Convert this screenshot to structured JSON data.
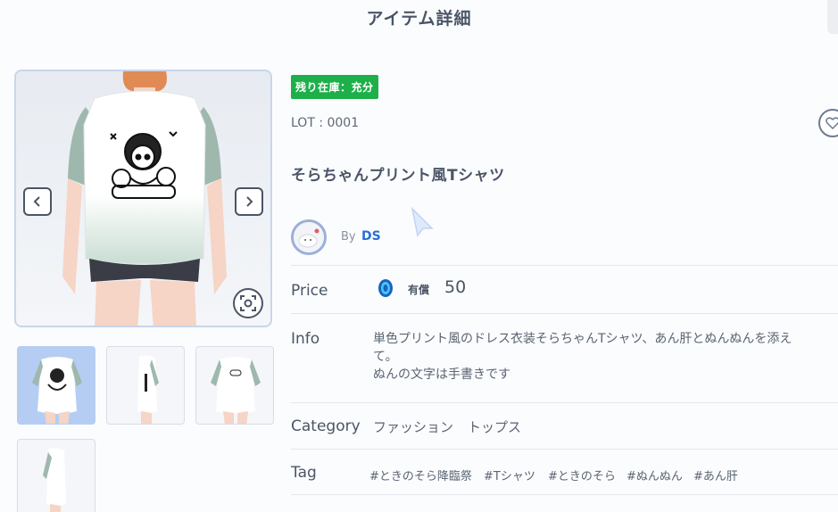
{
  "header": {
    "title": "アイテム詳細"
  },
  "item": {
    "stock_badge": "残り在庫：充分",
    "lot": "LOT : 0001",
    "name": "そらちゃんプリント風Tシャツ",
    "creator_by": "By",
    "creator_name": "DS"
  },
  "details": {
    "price_label": "Price",
    "price_type": "有償",
    "price_value": "50",
    "info_label": "Info",
    "info_lines": [
      "単色プリント風のドレス衣装そらちゃんTシャツ、あん肝とぬんぬんを添え",
      "て。",
      "ぬんの文字は手書きです"
    ],
    "category_label": "Category",
    "categories": [
      "ファッション",
      "トップス"
    ],
    "tag_label": "Tag",
    "tags": [
      "#ときのそら降臨祭",
      "#Tシャツ",
      "#ときのそら",
      "#ぬんぬん",
      "#あん肝"
    ]
  },
  "gallery": {
    "thumbnail_count": 4,
    "selected_index": 0
  },
  "colors": {
    "accent_blue": "#2a6fd6",
    "stock_green": "#1db04a",
    "selected_thumb": "#b5cdf3"
  }
}
